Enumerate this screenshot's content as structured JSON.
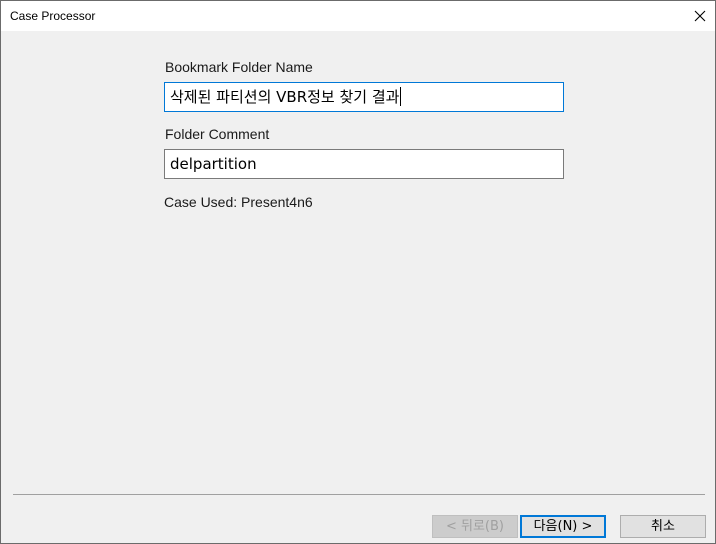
{
  "window": {
    "title": "Case Processor",
    "close_icon": "close-icon"
  },
  "form": {
    "bookmark_folder_name_label": "Bookmark Folder Name",
    "bookmark_folder_name_value": "삭제된 파티션의 VBR정보 찾기 결과",
    "folder_comment_label": "Folder Comment",
    "folder_comment_value": "delpartition",
    "case_used_text": "Case Used: Present4n6"
  },
  "buttons": {
    "back_label": "< 뒤로(B)",
    "next_label": "다음(N) >",
    "cancel_label": "취소"
  },
  "colors": {
    "dialog_background": "#f0f0f0",
    "focus_border": "#0078d7"
  }
}
